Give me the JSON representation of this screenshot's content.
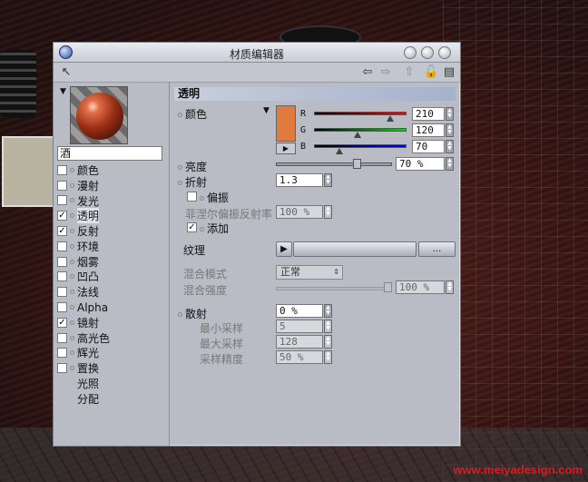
{
  "window": {
    "title": "材质编辑器"
  },
  "material": {
    "name": "酒"
  },
  "channels": [
    {
      "label": "颜色",
      "checked": false
    },
    {
      "label": "漫射",
      "checked": false
    },
    {
      "label": "发光",
      "checked": false
    },
    {
      "label": "透明",
      "checked": true,
      "selected": true
    },
    {
      "label": "反射",
      "checked": true
    },
    {
      "label": "环境",
      "checked": false
    },
    {
      "label": "烟雾",
      "checked": false
    },
    {
      "label": "凹凸",
      "checked": false
    },
    {
      "label": "法线",
      "checked": false
    },
    {
      "label": "Alpha",
      "checked": false
    },
    {
      "label": "镜射",
      "checked": true
    },
    {
      "label": "高光色",
      "checked": false
    },
    {
      "label": "辉光",
      "checked": false
    },
    {
      "label": "置换",
      "checked": false
    },
    {
      "label": "光照",
      "checked": null
    },
    {
      "label": "分配",
      "checked": null
    }
  ],
  "section": {
    "title": "透明"
  },
  "color": {
    "label": "颜色",
    "swatch": "#e17a3e",
    "r": {
      "label": "R",
      "value": "210",
      "fraction": 0.82
    },
    "g": {
      "label": "G",
      "value": "120",
      "fraction": 0.47
    },
    "b": {
      "label": "B",
      "value": "70",
      "fraction": 0.27
    }
  },
  "brightness": {
    "label": "亮度",
    "value": "70 %",
    "fraction": 0.7
  },
  "refraction": {
    "label": "折射",
    "value": "1.3"
  },
  "polarize": {
    "label": "偏振",
    "checked": false
  },
  "fresnel": {
    "label": "菲涅尔偏振反射率",
    "value": "100 %"
  },
  "additive": {
    "label": "添加",
    "checked": true
  },
  "texture": {
    "label": "纹理",
    "more": "..."
  },
  "blend_mode": {
    "label": "混合模式",
    "value": "正常"
  },
  "blend_strength": {
    "label": "混合强度",
    "value": "100 %",
    "fraction": 1.0
  },
  "scatter": {
    "label": "散射",
    "value": "0 %"
  },
  "min_samples": {
    "label": "最小采样",
    "value": "5"
  },
  "max_samples": {
    "label": "最大采样",
    "value": "128"
  },
  "sample_accuracy": {
    "label": "采样精度",
    "value": "50 %"
  },
  "watermark": "www.meiyadesign.com"
}
